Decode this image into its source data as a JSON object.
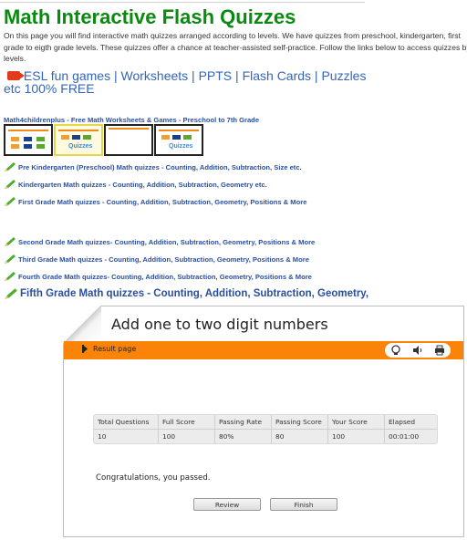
{
  "page": {
    "title": "Math Interactive Flash Quizzes",
    "intro": "On this page you will find interactive math quizzes arranged according to levels. We have quizzes from preschool, kindergarten, first grade to eigth grade levels. These quizzes offer a chance at teacher-assisted self-practice. Follow the links below to access quizzes by levels.",
    "esl_link": "ESL fun games | Worksheets | PPTS | Flash Cards | Puzzles etc 100% FREE",
    "m4c_link": "Math4childrenplus - Free Math Worksheets & Games - Preschool to 7th Grade",
    "thumbnail_label": "Quizzes",
    "links_group1": [
      "Pre Kindergarten (Preschool) Math quizzes - Counting, Addition, Subtraction, Size etc.",
      "Kindergarten Math quizzes - Counting, Addition, Subtraction, Geometry etc.",
      "First Grade Math quizzes - Counting, Addition, Subtraction, Geometry, Positions & More"
    ],
    "links_group2": [
      "Second Grade Math quizzes- Counting, Addition, Subtraction, Geometry, Positions & More",
      "Third Grade Math quizzes - Counting, Addition, Subtraction, Geometry, Positions & More",
      "Fourth Grade Math quizzes- Counting, Addition, Subtraction, Geometry, Positions & More"
    ],
    "fifth_link": "Fifth Grade Math quizzes - Counting, Addition, Subtraction, Geometry,"
  },
  "quiz": {
    "title": "Add one to two digit numbers",
    "result_label": "Result page",
    "tools": [
      "hint-icon",
      "sound-icon",
      "print-icon"
    ],
    "table": {
      "headers": [
        "Total Questions",
        "Full Score",
        "Passing Rate",
        "Passing Score",
        "Your Score",
        "Elapsed"
      ],
      "values": [
        "10",
        "100",
        "80%",
        "80",
        "100",
        "00:01:00"
      ]
    },
    "message": "Congratulations, you passed.",
    "review_label": "Review",
    "finish_label": "Finish",
    "accent": "#f98408"
  }
}
